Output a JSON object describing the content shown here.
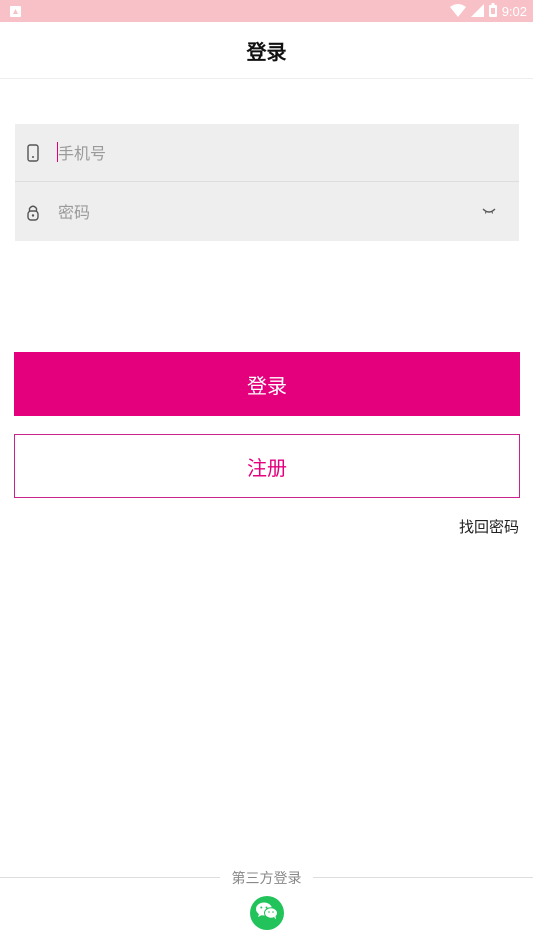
{
  "status_bar": {
    "time": "9:02",
    "app_icon": "android-notification-icon",
    "icons": [
      "wifi-icon",
      "signal-icon",
      "battery-icon"
    ],
    "background": "#f7c1c7"
  },
  "header": {
    "title": "登录"
  },
  "form": {
    "phone": {
      "placeholder": "手机号",
      "value": "",
      "icon": "phone-icon"
    },
    "password": {
      "placeholder": "密码",
      "value": "",
      "icon": "lock-icon",
      "toggle_icon": "eye-closed-icon"
    }
  },
  "actions": {
    "login_label": "登录",
    "register_label": "注册",
    "forgot_label": "找回密码"
  },
  "third_party": {
    "label": "第三方登录",
    "providers": [
      "wechat-icon"
    ]
  },
  "colors": {
    "accent": "#e4007c",
    "wechat": "#22c35a",
    "field_bg": "#eeeeee"
  }
}
